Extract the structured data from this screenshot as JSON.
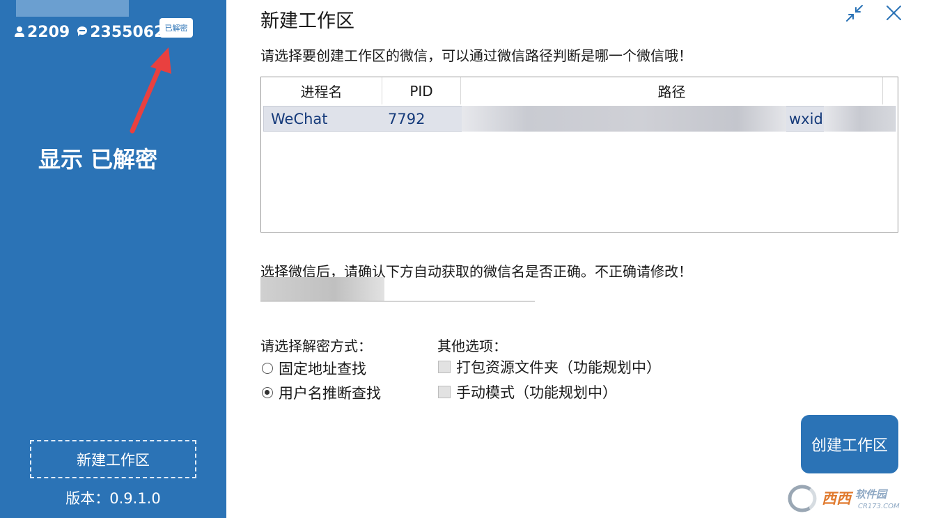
{
  "sidebar": {
    "user_count": "2209",
    "message_count": "2355062",
    "decrypt_badge": "已解密",
    "annotation": "显示 已解密",
    "new_workspace_label": "新建工作区",
    "version_label": "版本：",
    "version_value": "0.9.1.0"
  },
  "header": {
    "title": "新建工作区"
  },
  "main": {
    "select_instruction": "请选择要创建工作区的微信，可以通过微信路径判断是哪一个微信哦！",
    "table": {
      "columns": [
        "进程名",
        "PID",
        "路径"
      ],
      "rows": [
        {
          "name": "WeChat",
          "pid": "7792",
          "path_visible": "wxid"
        }
      ]
    },
    "confirm_instruction": "选择微信后，请确认下方自动获取的微信名是否正确。不正确请修改！",
    "decrypt_method": {
      "label": "请选择解密方式：",
      "options": [
        "固定地址查找",
        "用户名推断查找"
      ],
      "selected": "用户名推断查找"
    },
    "other_options": {
      "label": "其他选项：",
      "options": [
        "打包资源文件夹（功能规划中）",
        "手动模式（功能规划中）"
      ]
    },
    "create_button": "创建工作区"
  },
  "watermark": {
    "brand": "西西软件园",
    "site": "CR173.COM"
  },
  "colors": {
    "sidebar_bg": "#2b73b6",
    "button_bg": "#2b73b6",
    "arrow": "#e9403f",
    "row_text": "#153a7a"
  },
  "icons": {
    "user": "user-icon",
    "messages": "chat-icon",
    "restore": "restore-icon",
    "close": "close-icon"
  }
}
